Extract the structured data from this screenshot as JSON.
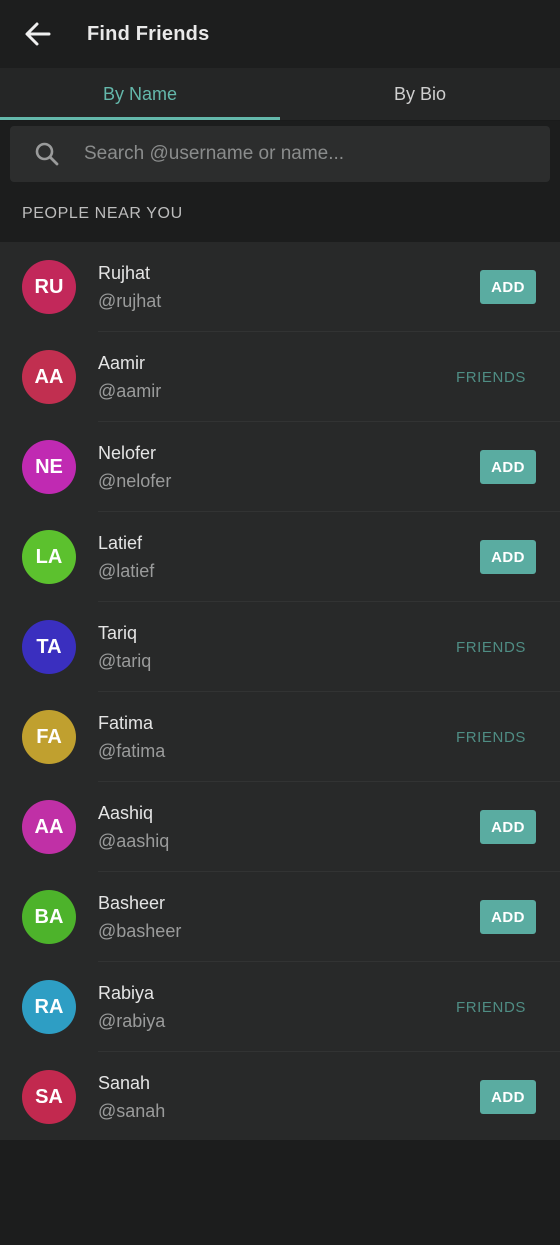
{
  "app_bar": {
    "title": "Find Friends",
    "back_icon": "arrow-left-icon"
  },
  "tabs": [
    {
      "label": "By Name",
      "active": true
    },
    {
      "label": "By Bio",
      "active": false
    }
  ],
  "search": {
    "placeholder": "Search @username or name...",
    "value": "",
    "icon": "search-icon"
  },
  "section": {
    "title": "PEOPLE NEAR YOU"
  },
  "colors": {
    "accent": "#64b8ab",
    "add_button": "#5aaca1",
    "friends_text": "#4f8d84",
    "background": "#1c1d1d",
    "list_background": "#282929"
  },
  "people": [
    {
      "initials": "RU",
      "name": "Rujhat",
      "handle": "@rujhat",
      "status": "add",
      "action_label": "ADD",
      "color": "#c2285a"
    },
    {
      "initials": "AA",
      "name": "Aamir",
      "handle": "@aamir",
      "status": "friends",
      "action_label": "FRIENDS",
      "color": "#c12f50"
    },
    {
      "initials": "NE",
      "name": "Nelofer",
      "handle": "@nelofer",
      "status": "add",
      "action_label": "ADD",
      "color": "#c02ab2"
    },
    {
      "initials": "LA",
      "name": "Latief",
      "handle": "@latief",
      "status": "add",
      "action_label": "ADD",
      "color": "#5cc12e"
    },
    {
      "initials": "TA",
      "name": "Tariq",
      "handle": "@tariq",
      "status": "friends",
      "action_label": "FRIENDS",
      "color": "#3a2fbf"
    },
    {
      "initials": "FA",
      "name": "Fatima",
      "handle": "@fatima",
      "status": "friends",
      "action_label": "FRIENDS",
      "color": "#c0a02f"
    },
    {
      "initials": "AA",
      "name": "Aashiq",
      "handle": "@aashiq",
      "status": "add",
      "action_label": "ADD",
      "color": "#c030a6"
    },
    {
      "initials": "BA",
      "name": "Basheer",
      "handle": "@basheer",
      "status": "add",
      "action_label": "ADD",
      "color": "#4db32b"
    },
    {
      "initials": "RA",
      "name": "Rabiya",
      "handle": "@rabiya",
      "status": "friends",
      "action_label": "FRIENDS",
      "color": "#2e9ec4"
    },
    {
      "initials": "SA",
      "name": "Sanah",
      "handle": "@sanah",
      "status": "add",
      "action_label": "ADD",
      "color": "#c2294f"
    }
  ]
}
